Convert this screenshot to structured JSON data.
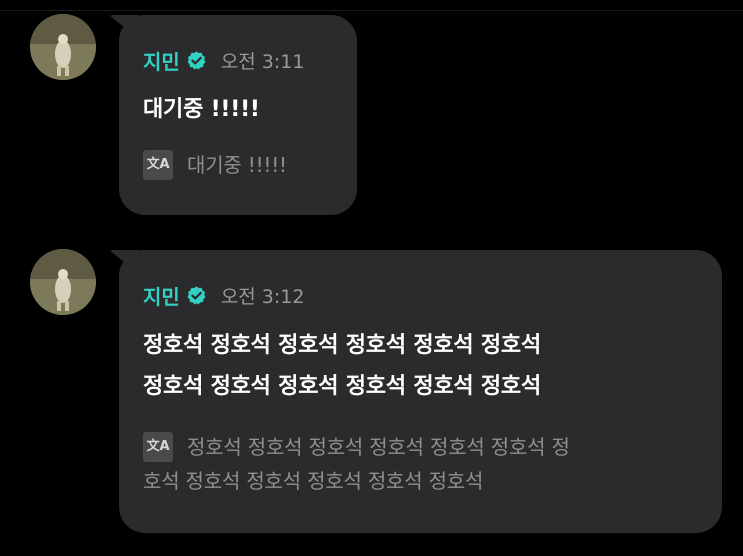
{
  "messages": [
    {
      "sender": "지민",
      "verified_icon": "verified-check-badge-icon",
      "time": "오전 3:11",
      "text_lines": [
        "대기중 !!!!!"
      ],
      "translation_icon": "translate-icon",
      "translation_icon_text": "文A",
      "translation_text": "대기중 !!!!!"
    },
    {
      "sender": "지민",
      "verified_icon": "verified-check-badge-icon",
      "time": "오전 3:12",
      "text_lines": [
        "정호석 정호석 정호석 정호석 정호석 정호석",
        "정호석 정호석 정호석 정호석 정호석 정호석"
      ],
      "translation_icon": "translate-icon",
      "translation_icon_text": "文A",
      "translation_lines": [
        "정호석 정호석 정호석 정호석 정호석 정호석 정",
        "호석 정호석 정호석 정호석 정호석 정호석"
      ]
    }
  ],
  "colors": {
    "background": "#000000",
    "bubble": "#2b2b2d",
    "sender_name": "#33d1c4",
    "timestamp": "#9a9a9a",
    "message_text": "#ffffff",
    "translation_text": "#8f8f8f"
  }
}
